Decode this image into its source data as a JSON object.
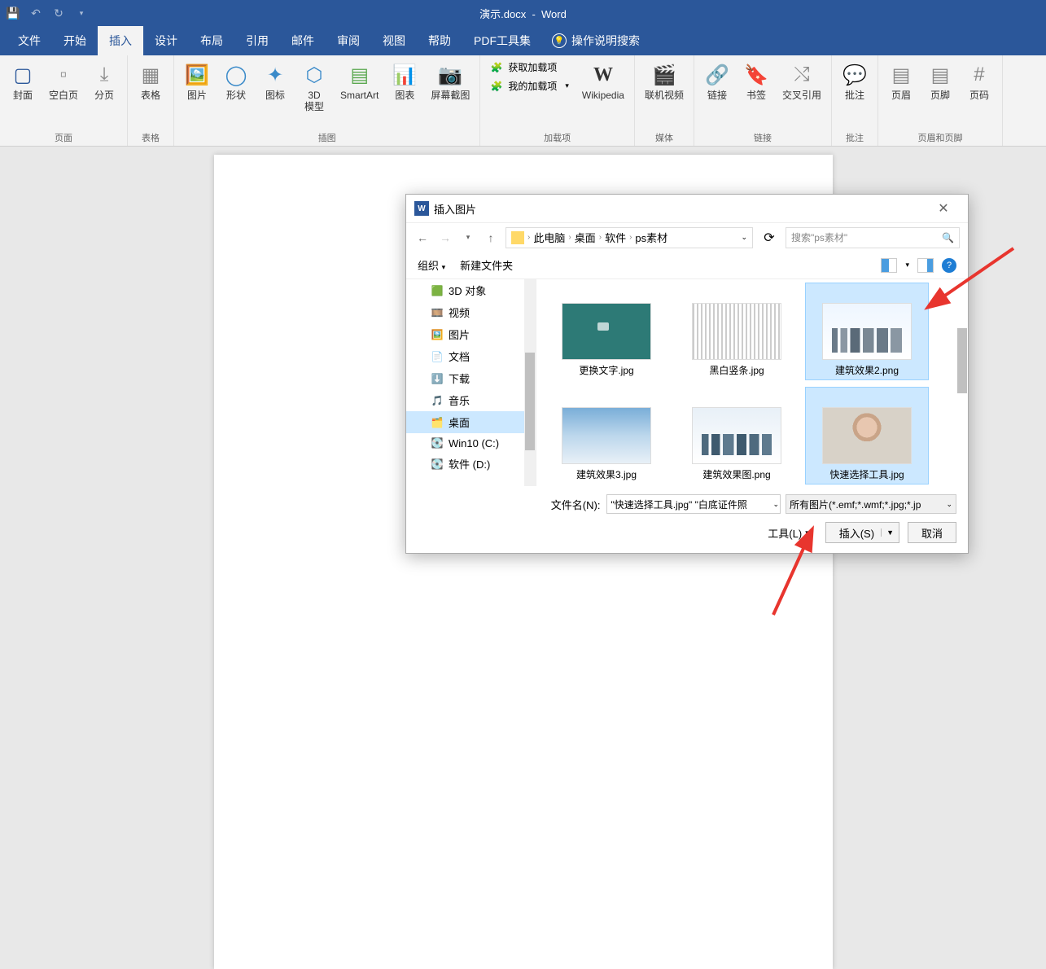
{
  "app": {
    "doc_title": "演示.docx",
    "app_name": "Word"
  },
  "qat": {
    "save": "保存",
    "undo": "撤销",
    "redo": "重做"
  },
  "tabs": {
    "file": "文件",
    "home": "开始",
    "insert": "插入",
    "design": "设计",
    "layout": "布局",
    "references": "引用",
    "mailings": "邮件",
    "review": "审阅",
    "view": "视图",
    "help": "帮助",
    "pdf": "PDF工具集",
    "tell_me": "操作说明搜索"
  },
  "ribbon": {
    "pages": {
      "label": "页面",
      "cover": "封面",
      "blank": "空白页",
      "break": "分页"
    },
    "tables": {
      "label": "表格",
      "table": "表格"
    },
    "illustrations": {
      "label": "插图",
      "pictures": "图片",
      "shapes": "形状",
      "icons": "图标",
      "model3d": "3D\n模型",
      "smartart": "SmartArt",
      "chart": "图表",
      "screenshot": "屏幕截图"
    },
    "addins": {
      "label": "加载项",
      "get": "获取加载项",
      "my": "我的加载项",
      "wikipedia": "Wikipedia"
    },
    "media": {
      "label": "媒体",
      "video": "联机视频"
    },
    "links": {
      "label": "链接",
      "link": "链接",
      "bookmark": "书签",
      "crossref": "交叉引用"
    },
    "comments": {
      "label": "批注",
      "comment": "批注"
    },
    "hf": {
      "label": "页眉和页脚",
      "header": "页眉",
      "footer": "页脚",
      "pagenum": "页码"
    }
  },
  "dialog": {
    "title": "插入图片",
    "breadcrumb": [
      "此电脑",
      "桌面",
      "软件",
      "ps素材"
    ],
    "search_placeholder": "搜索\"ps素材\"",
    "organize": "组织",
    "new_folder": "新建文件夹",
    "tree": [
      {
        "name": "3D 对象",
        "icon": "cube"
      },
      {
        "name": "视频",
        "icon": "video"
      },
      {
        "name": "图片",
        "icon": "image"
      },
      {
        "name": "文档",
        "icon": "doc"
      },
      {
        "name": "下载",
        "icon": "download"
      },
      {
        "name": "音乐",
        "icon": "music"
      },
      {
        "name": "桌面",
        "icon": "desktop",
        "selected": true
      },
      {
        "name": "Win10 (C:)",
        "icon": "disk"
      },
      {
        "name": "软件 (D:)",
        "icon": "disk"
      }
    ],
    "files": [
      {
        "name": "更换文字.jpg",
        "thumb": "teal"
      },
      {
        "name": "黑白竖条.jpg",
        "thumb": "stripes"
      },
      {
        "name": "建筑效果2.png",
        "thumb": "buildings",
        "selected": true
      },
      {
        "name": "建筑效果3.jpg",
        "thumb": "sky"
      },
      {
        "name": "建筑效果图.png",
        "thumb": "city"
      },
      {
        "name": "快速选择工具.jpg",
        "thumb": "person",
        "selected": true
      }
    ],
    "filename_label": "文件名(N):",
    "filename_value": "\"快速选择工具.jpg\" \"白底证件照",
    "filter": "所有图片(*.emf;*.wmf;*.jpg;*.jp",
    "tools": "工具(L)",
    "insert": "插入(S)",
    "cancel": "取消"
  }
}
